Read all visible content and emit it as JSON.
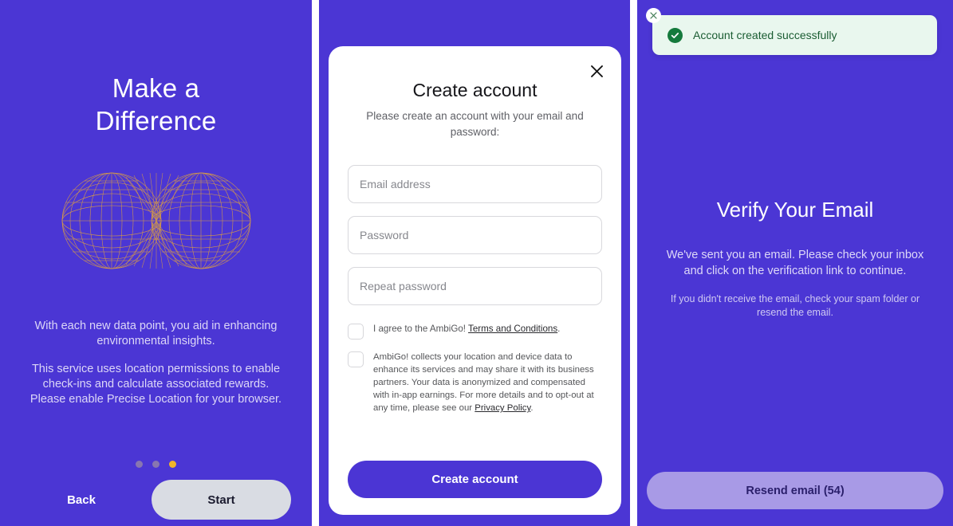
{
  "theme": {
    "brand_purple": "#4b36d4",
    "accent_gold": "#f0b429",
    "globe_stroke": "#e0a23c",
    "success_green": "#157a3c",
    "toast_bg": "#e9f7ee",
    "disabled_button": "#a89ae6",
    "start_button_bg": "#d9dce3"
  },
  "onboarding": {
    "title": "Make a Difference",
    "title_line_1": "Make a",
    "title_line_2": "Difference",
    "graphic": "wireframe-globes",
    "body_1": "With each new data point, you aid in enhancing environmental insights.",
    "body_2": "This service uses location permissions to enable check-ins and calculate associated rewards. Please enable Precise Location for your browser.",
    "pagination": {
      "total": 3,
      "active_index": 3,
      "dots": [
        "muted",
        "muted",
        "active"
      ]
    },
    "back_label": "Back",
    "start_label": "Start"
  },
  "modal": {
    "close_icon": "close-icon",
    "title": "Create account",
    "subtitle": "Please create an account with your email and password:",
    "fields": [
      {
        "name": "email",
        "placeholder": "Email address",
        "value": ""
      },
      {
        "name": "password",
        "placeholder": "Password",
        "value": ""
      },
      {
        "name": "repeat_password",
        "placeholder": "Repeat password",
        "value": ""
      }
    ],
    "consent_1": {
      "checked": false,
      "text_before": "I agree to the AmbiGo! ",
      "link": "Terms and Conditions",
      "text_after": "."
    },
    "consent_2": {
      "checked": false,
      "text_before": "AmbiGo! collects your location and device data to enhance its services and may share it with its business partners. Your data is anonymized and compensated with in-app earnings. For more details and to opt-out at any time, please see our ",
      "link": "Privacy Policy",
      "text_after": "."
    },
    "submit_label": "Create account"
  },
  "verify": {
    "title": "Verify Your Email",
    "body_1": "We've sent you an email. Please check your inbox and click on the verification link to continue.",
    "body_2": "If you didn't receive the email, check your spam folder or resend the email.",
    "resend_label": "Resend email (54)",
    "resend_seconds": 54,
    "resend_enabled": false
  },
  "toast": {
    "message": "Account created successfully",
    "status": "success",
    "icon": "check-circle-icon",
    "close_icon": "close-icon"
  }
}
